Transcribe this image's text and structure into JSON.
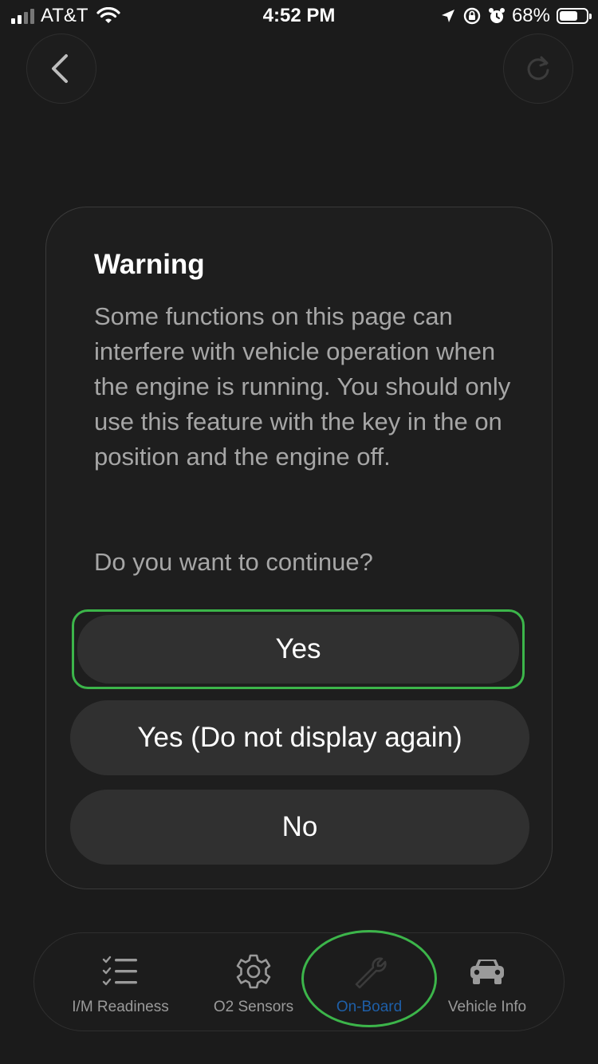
{
  "status_bar": {
    "carrier": "AT&T",
    "time": "4:52 PM",
    "battery_percent": "68%",
    "battery_level": 0.68,
    "icons": [
      "signal-icon",
      "wifi-icon",
      "location-icon",
      "rotation-lock-icon",
      "alarm-icon",
      "battery-icon"
    ]
  },
  "nav": {
    "back_icon": "chevron-left-icon",
    "refresh_icon": "refresh-icon"
  },
  "dialog": {
    "title": "Warning",
    "body": "Some functions on this page can interfere with vehicle operation when the engine is running. You should only use this feature with the key in the on position and the engine off.",
    "question": "Do you want to continue?",
    "buttons": {
      "yes": "Yes",
      "yes_dont_show": "Yes (Do not display again)",
      "no": "No"
    }
  },
  "tab_bar": {
    "tabs": [
      {
        "label": "I/M Readiness",
        "icon": "checklist-icon"
      },
      {
        "label": "O2 Sensors",
        "icon": "gear-icon"
      },
      {
        "label": "On-Board",
        "icon": "wrench-icon",
        "active": true
      },
      {
        "label": "Vehicle Info",
        "icon": "car-icon"
      }
    ]
  },
  "colors": {
    "background": "#1b1b1b",
    "dialog": "#1e1e1e",
    "button": "#303030",
    "highlight": "#3cb54a",
    "active_tab": "#1e5fa8",
    "body_text": "#a6a6a6"
  }
}
